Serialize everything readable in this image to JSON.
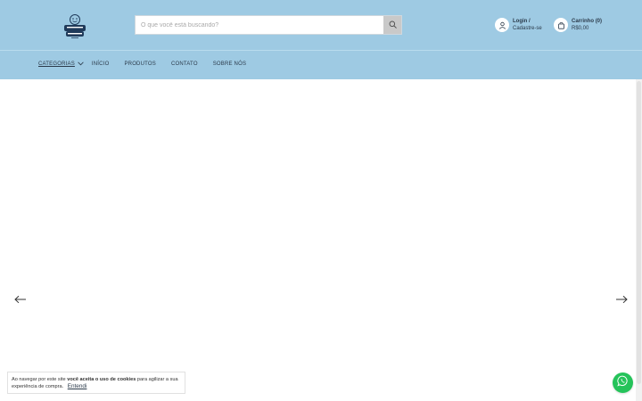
{
  "header": {
    "bg_color": "#9ecae3",
    "logo_icon": "cresci-logo-icon"
  },
  "search": {
    "placeholder": "O que você está buscando?",
    "button_icon": "search-icon"
  },
  "account": {
    "icon": "user-icon",
    "line1": "Login /",
    "line2": "Cadastre-se"
  },
  "cart": {
    "icon": "bag-icon",
    "label": "Carrinho",
    "count": "(0)",
    "total": "R$0,00"
  },
  "nav": {
    "items": [
      {
        "label": "CATEGORIAS"
      },
      {
        "label": "INÍCIO"
      },
      {
        "label": "PRODUTOS"
      },
      {
        "label": "CONTATO"
      },
      {
        "label": "SOBRE NÓS"
      }
    ]
  },
  "carousel": {
    "prev_icon": "arrow-left-icon",
    "next_icon": "arrow-right-icon"
  },
  "cookie": {
    "text_before": "Ao navegar por este site ",
    "text_bold": "você aceita o uso de cookies",
    "text_after": " para agilizar a sua experiência de compra.",
    "accept_label": "Entendi"
  },
  "whatsapp": {
    "icon": "whatsapp-icon",
    "color": "#25c35a"
  }
}
